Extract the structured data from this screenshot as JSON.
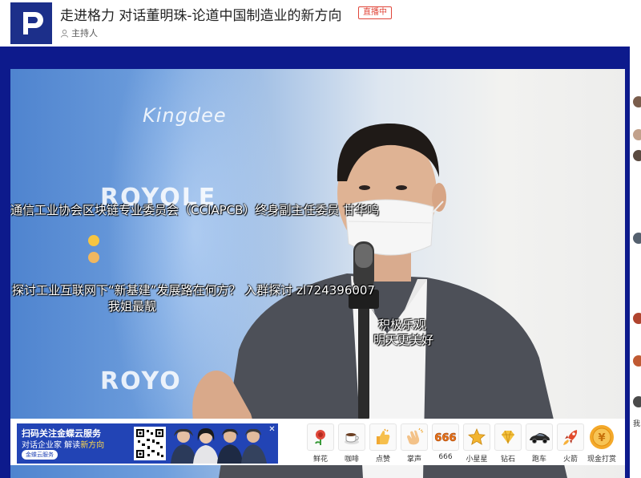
{
  "header": {
    "title": "走进格力 对话董明珠-论道中国制造业的新方向",
    "live_badge": "直播中",
    "host_label": "主持人"
  },
  "video": {
    "brand_texts": [
      "Kingdee",
      "ROYOLE",
      "ROYO"
    ]
  },
  "danmaku": [
    "通信工业协会区块链专业委员会（CCIAPCB）终身副主任委员 甘华鸣",
    "探讨工业互联网下“新基建”发展路在何方？ 入群探讨 zl724396007",
    "我姐最靓",
    "积极乐观",
    "明天更美好"
  ],
  "ad": {
    "line1": "扫码关注金蝶云服务",
    "line2_prefix": "对话企业家 解读",
    "line2_highlight": "新方向",
    "pill": "金蝶云服务",
    "close": "✕"
  },
  "gifts": [
    {
      "label": "鲜花",
      "icon": "flower-icon"
    },
    {
      "label": "咖啡",
      "icon": "coffee-icon"
    },
    {
      "label": "点赞",
      "icon": "thumbs-up-icon"
    },
    {
      "label": "掌声",
      "icon": "clap-icon"
    },
    {
      "label": "666",
      "icon": "666-icon"
    },
    {
      "label": "小星星",
      "icon": "star-icon"
    },
    {
      "label": "钻石",
      "icon": "diamond-icon"
    },
    {
      "label": "跑车",
      "icon": "sports-car-icon"
    },
    {
      "label": "火箭",
      "icon": "rocket-icon"
    },
    {
      "label": "现金打赏",
      "icon": "cash-coin-icon"
    }
  ],
  "side_char": "我",
  "colors": {
    "brand_blue": "#1c2f8a",
    "stage_blue": "#0d1a8c",
    "live_red": "#e0463a",
    "ad_blue": "#2244b5"
  }
}
